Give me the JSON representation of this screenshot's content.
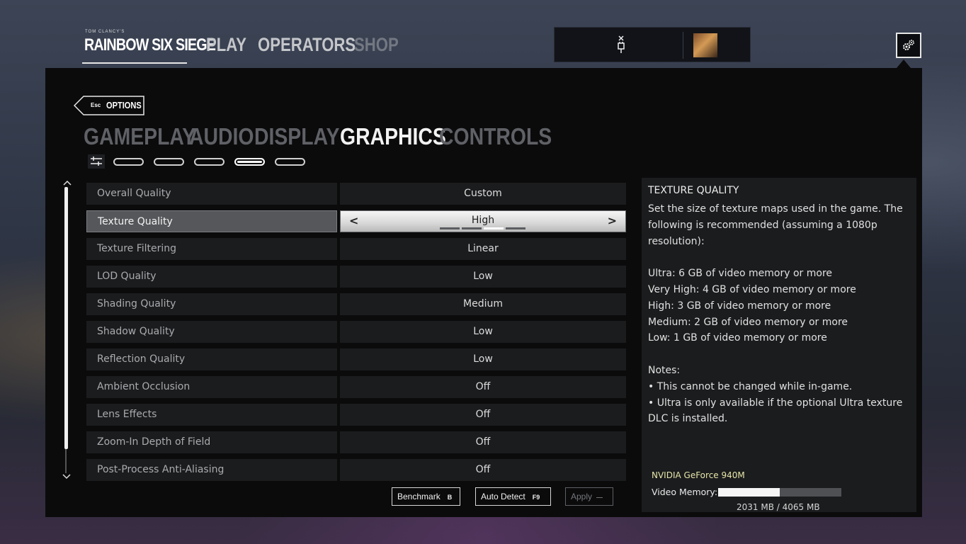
{
  "nav": {
    "logo_small": "TOM CLANCY'S",
    "logo_main": "RAINBOW SIX SIEGE",
    "items": [
      {
        "label": "PLAY",
        "state": "normal"
      },
      {
        "label": "OPERATORS",
        "state": "normal"
      },
      {
        "label": "SHOP",
        "state": "dim"
      }
    ],
    "colors": {
      "normal": "#c4c6ca",
      "dim": "#737882"
    }
  },
  "header": {
    "back_key": "Esc",
    "back_label": "OPTIONS",
    "tabs": [
      {
        "label": "GAMEPLAY",
        "active": false
      },
      {
        "label": "AUDIO",
        "active": false
      },
      {
        "label": "DISPLAY",
        "active": false
      },
      {
        "label": "GRAPHICS",
        "active": true
      },
      {
        "label": "CONTROLS",
        "active": false
      }
    ],
    "subtab_active_index": 3,
    "subtab_count": 5
  },
  "settings": [
    {
      "name": "Overall Quality",
      "value": "Custom"
    },
    {
      "name": "Texture Quality",
      "value": "High",
      "selected": true,
      "steps": 4,
      "step_index": 2
    },
    {
      "name": "Texture Filtering",
      "value": "Linear"
    },
    {
      "name": "LOD Quality",
      "value": "Low"
    },
    {
      "name": "Shading Quality",
      "value": "Medium"
    },
    {
      "name": "Shadow Quality",
      "value": "Low"
    },
    {
      "name": "Reflection Quality",
      "value": "Low"
    },
    {
      "name": "Ambient Occlusion",
      "value": "Off"
    },
    {
      "name": "Lens Effects",
      "value": "Off"
    },
    {
      "name": "Zoom-In Depth of Field",
      "value": "Off"
    },
    {
      "name": "Post-Process Anti-Aliasing",
      "value": "Off"
    }
  ],
  "buttons": {
    "benchmark": {
      "label": "Benchmark",
      "key": "B"
    },
    "auto_detect": {
      "label": "Auto Detect",
      "key": "F9"
    },
    "apply": {
      "label": "Apply",
      "key": "—"
    }
  },
  "description": {
    "title": "TEXTURE QUALITY",
    "body": "Set the size of texture maps used in the game. The following is recommended (assuming a 1080p resolution):\n\nUltra: 6 GB of video memory or more\nVery High: 4 GB of video memory or more\nHigh: 3 GB of video memory or more\nMedium: 2 GB of video memory or more\nLow: 1 GB of video memory or more\n\nNotes:\n• This cannot be changed while in-game.\n• Ultra is only available if the optional Ultra texture DLC is installed.",
    "gpu": "NVIDIA GeForce 940M",
    "vram_label": "Video Memory:",
    "vram_text": "2031 MB / 4065 MB",
    "vram_fraction": 0.4996
  },
  "icons": {
    "settings": "gear-icon",
    "connection": "plug-icon",
    "back": "back-arrow-icon",
    "scroll_up": "chevron-up-icon",
    "scroll_down": "chevron-down-icon",
    "subtab_first": "sliders-icon",
    "prev": "chevron-left-icon",
    "next": "chevron-right-icon"
  }
}
